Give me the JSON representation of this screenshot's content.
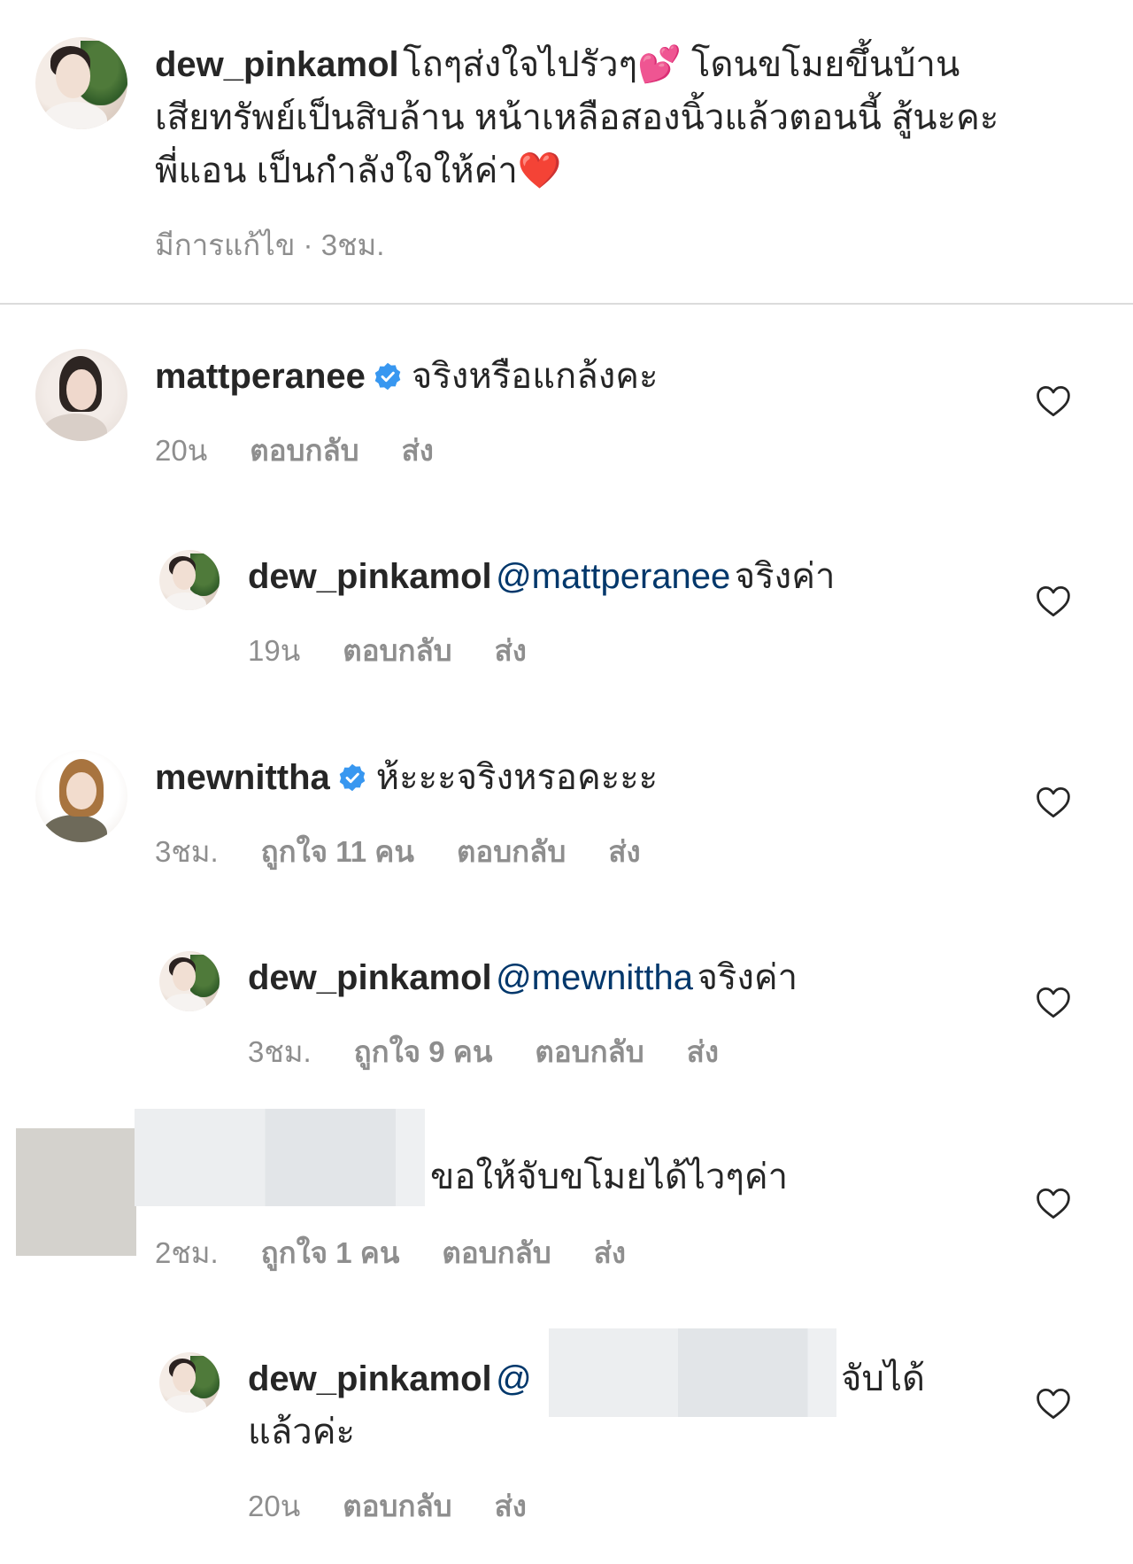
{
  "post": {
    "username": "dew_pinkamol",
    "caption_line1": "โถๆส่งใจไปรัวๆ💕 โดนขโมยขึ้นบ้าน",
    "caption_line2": "เสียทรัพย์เป็นสิบล้าน หน้าเหลือสองนิ้วแล้วตอนนี้ สู้นะคะ",
    "caption_line3": "พี่แอน เป็นกำลังใจให้ค่า❤️",
    "meta": "มีการแก้ไข · 3ชม."
  },
  "labels": {
    "reply": "ตอบกลับ",
    "send": "ส่ง"
  },
  "comments": [
    {
      "username": "mattperanee",
      "verified": true,
      "text": "จริงหรือแกล้งคะ",
      "time": "20น"
    },
    {
      "username": "dew_pinkamol",
      "mention": "@mattperanee",
      "text": "จริงค่า",
      "time": "19น"
    },
    {
      "username": "mewnittha",
      "verified": true,
      "text": "ห้ะะะจริงหรอคะะะ",
      "time": "3ชม.",
      "likes": "ถูกใจ 11 คน"
    },
    {
      "username": "dew_pinkamol",
      "mention": "@mewnittha",
      "text": "จริงค่า",
      "time": "3ชม.",
      "likes": "ถูกใจ 9 คน"
    },
    {
      "text": "ขอให้จับขโมยได้ไวๆค่า",
      "time": "2ชม.",
      "likes": "ถูกใจ 1 คน"
    },
    {
      "username": "dew_pinkamol",
      "mention_partial": "@",
      "text_line1": "จับได้",
      "text_line2": "แล้วค่ะ",
      "time": "20น"
    }
  ],
  "colors": {
    "mention": "#00376b",
    "meta": "#8e8e8e",
    "verified": "#3897f0"
  },
  "icons": [
    "heart-outline-icon",
    "verified-badge-icon"
  ]
}
